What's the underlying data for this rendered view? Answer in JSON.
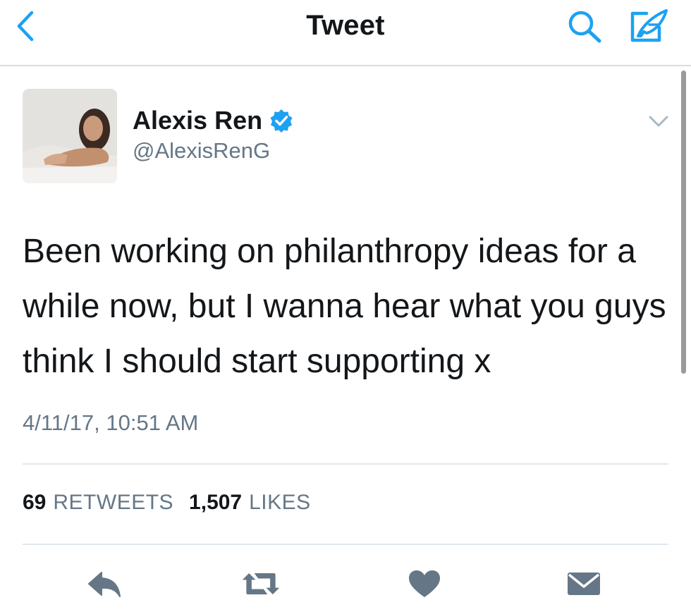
{
  "nav": {
    "title": "Tweet",
    "back_icon": "chevron-left-icon",
    "search_icon": "search-icon",
    "compose_icon": "compose-icon"
  },
  "colors": {
    "accent": "#1da1f2",
    "text": "#14171a",
    "secondary": "#657786",
    "action_icon": "#657786",
    "divider": "#e1e8ed"
  },
  "tweet": {
    "author_name": "Alexis Ren",
    "verified": true,
    "handle": "@AlexisRenG",
    "text": "Been working on philanthropy ideas for a while now, but I wanna hear what you guys think I should start supporting x",
    "timestamp": "4/11/17, 10:51 AM"
  },
  "stats": {
    "retweets_count": "69",
    "retweets_label": "RETWEETS",
    "likes_count": "1,507",
    "likes_label": "LIKES"
  },
  "actions": {
    "reply_icon": "reply-icon",
    "retweet_icon": "retweet-icon",
    "like_icon": "heart-icon",
    "message_icon": "envelope-icon"
  }
}
